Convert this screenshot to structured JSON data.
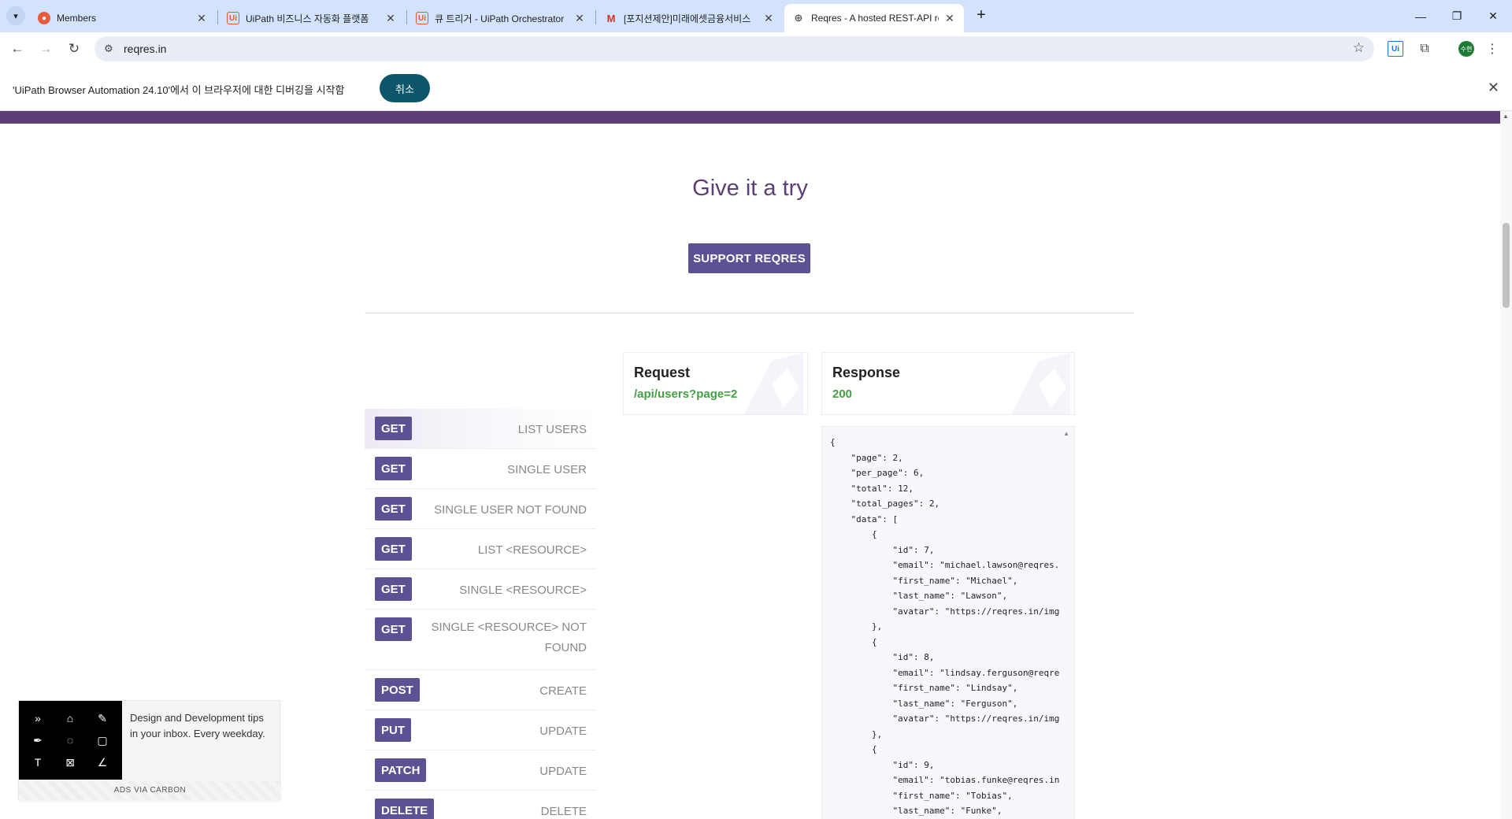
{
  "browser": {
    "tabs": [
      {
        "title": "Members",
        "favicon": "members-icon",
        "active": false
      },
      {
        "title": "UiPath 비즈니스 자동화 플랫폼",
        "favicon": "uipath-icon",
        "active": false
      },
      {
        "title": "큐 트리거 - UiPath Orchestrator",
        "favicon": "uipath-icon",
        "active": false
      },
      {
        "title": "[포지션제안]미래에셋금융서비스",
        "favicon": "gmail-icon",
        "active": false
      },
      {
        "title": "Reqres - A hosted REST-API re",
        "favicon": "globe-icon",
        "active": true
      }
    ],
    "address": "reqres.in",
    "profile_initial": "수현"
  },
  "infobar": {
    "message": "'UiPath Browser Automation 24.10'에서 이 브라우저에 대한 디버깅을 시작함",
    "cancel_label": "취소"
  },
  "page": {
    "title": "Give it a try",
    "support_label": "SUPPORT REQRES",
    "endpoints": [
      {
        "method": "GET",
        "label": "LIST USERS",
        "active": true
      },
      {
        "method": "GET",
        "label": "SINGLE USER"
      },
      {
        "method": "GET",
        "label": "SINGLE USER NOT FOUND"
      },
      {
        "method": "GET",
        "label": "LIST <RESOURCE>"
      },
      {
        "method": "GET",
        "label": "SINGLE <RESOURCE>"
      },
      {
        "method": "GET",
        "label": "SINGLE <RESOURCE> NOT FOUND"
      },
      {
        "method": "POST",
        "label": "CREATE"
      },
      {
        "method": "PUT",
        "label": "UPDATE"
      },
      {
        "method": "PATCH",
        "label": "UPDATE"
      },
      {
        "method": "DELETE",
        "label": "DELETE"
      }
    ],
    "request": {
      "title": "Request",
      "value": "/api/users?page=2"
    },
    "response": {
      "title": "Response",
      "value": "200"
    },
    "response_body": "{\n    \"page\": 2,\n    \"per_page\": 6,\n    \"total\": 12,\n    \"total_pages\": 2,\n    \"data\": [\n        {\n            \"id\": 7,\n            \"email\": \"michael.lawson@reqres.\n            \"first_name\": \"Michael\",\n            \"last_name\": \"Lawson\",\n            \"avatar\": \"https://reqres.in/img\n        },\n        {\n            \"id\": 8,\n            \"email\": \"lindsay.ferguson@reqre\n            \"first_name\": \"Lindsay\",\n            \"last_name\": \"Ferguson\",\n            \"avatar\": \"https://reqres.in/img\n        },\n        {\n            \"id\": 9,\n            \"email\": \"tobias.funke@reqres.in\n            \"first_name\": \"Tobias\",\n            \"last_name\": \"Funke\","
  },
  "ad": {
    "text": "Design and Development tips in your inbox. Every weekday.",
    "via": "ADS VIA CARBON"
  },
  "colors": {
    "brand_purple": "#5d3e75",
    "method_badge": "#5d5093",
    "success_green": "#42a142"
  }
}
